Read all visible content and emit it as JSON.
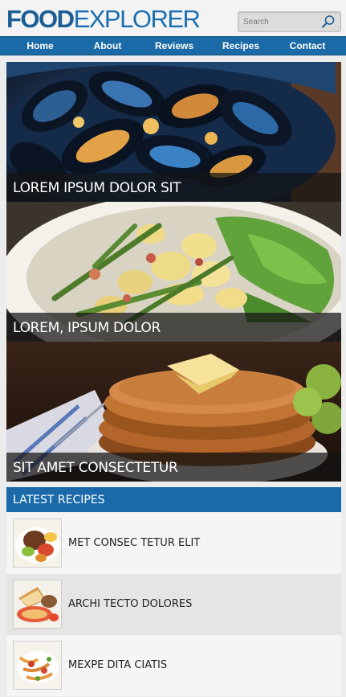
{
  "logo": {
    "part1": "FOOD",
    "part2": "EXPLORER"
  },
  "search": {
    "placeholder": "Search",
    "icon": "search-icon"
  },
  "nav": {
    "items": [
      {
        "label": "Home"
      },
      {
        "label": "About"
      },
      {
        "label": "Reviews"
      },
      {
        "label": "Recipes"
      },
      {
        "label": "Contact"
      }
    ]
  },
  "features": [
    {
      "caption": "LOREM IPSUM DOLOR SIT"
    },
    {
      "caption": "LOREM, IPSUM DOLOR"
    },
    {
      "caption": "SIT AMET CONSECTETUR"
    }
  ],
  "latest": {
    "heading": "LATEST RECIPES",
    "items": [
      {
        "title": "MET CONSEC TETUR ELIT"
      },
      {
        "title": "ARCHI TECTO DOLORES"
      },
      {
        "title": "MEXPE DITA CIATIS"
      }
    ]
  },
  "colors": {
    "brand_dark": "#1c5d94",
    "brand": "#1b6aa8",
    "caption_overlay": "#141414"
  }
}
